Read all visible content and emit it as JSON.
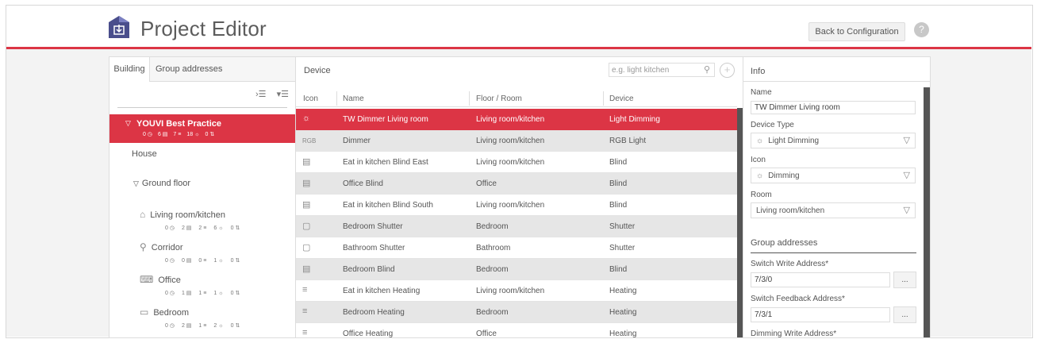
{
  "header": {
    "title": "Project Editor",
    "back_label": "Back to Configuration",
    "help_label": "?"
  },
  "colors": {
    "accent": "#dc3545",
    "selected_row": "#dc3545"
  },
  "left": {
    "tabs": [
      {
        "label": "Building"
      },
      {
        "label": "Group addresses"
      }
    ],
    "tree_tools": [
      "›☰",
      "▾☰"
    ],
    "root": {
      "name": "YOUVI Best Practice",
      "stats": [
        "0 ◷",
        "6 ▤",
        "7 ≡",
        "18 ☼",
        "0 ⇅"
      ]
    },
    "house": "House",
    "floor": "Ground floor",
    "rooms": [
      {
        "name": "Living room/kitchen",
        "icon": "sofa-icon",
        "glyph": "⌂",
        "stats": [
          "0 ◷",
          "2 ▤",
          "2 ≡",
          "6 ☼",
          "0 ⇅"
        ]
      },
      {
        "name": "Corridor",
        "icon": "coat-rack-icon",
        "glyph": "⚲",
        "stats": [
          "0 ◷",
          "0 ▤",
          "0 ≡",
          "1 ☼",
          "0 ⇅"
        ]
      },
      {
        "name": "Office",
        "icon": "desk-icon",
        "glyph": "⌨",
        "stats": [
          "0 ◷",
          "1 ▤",
          "1 ≡",
          "1 ☼",
          "0 ⇅"
        ]
      },
      {
        "name": "Bedroom",
        "icon": "bed-icon",
        "glyph": "▭",
        "stats": [
          "0 ◷",
          "2 ▤",
          "1 ≡",
          "2 ☼",
          "0 ⇅"
        ]
      }
    ]
  },
  "middle": {
    "title": "Device",
    "search_placeholder": "e.g. light kitchen",
    "columns": [
      "Icon",
      "Name",
      "Floor / Room",
      "Device"
    ],
    "rows": [
      {
        "icon": "dimmer-icon",
        "glyph": "☼",
        "name": "TW Dimmer Living room",
        "room": "Living room/kitchen",
        "device": "Light Dimming"
      },
      {
        "icon": "rgb-icon",
        "glyph": "RGB",
        "name": "Dimmer",
        "room": "Living room/kitchen",
        "device": "RGB Light"
      },
      {
        "icon": "blind-icon",
        "glyph": "▤",
        "name": "Eat in kitchen Blind East",
        "room": "Living room/kitchen",
        "device": "Blind"
      },
      {
        "icon": "blind-icon",
        "glyph": "▤",
        "name": "Office Blind",
        "room": "Office",
        "device": "Blind"
      },
      {
        "icon": "blind-icon",
        "glyph": "▤",
        "name": "Eat in kitchen Blind South",
        "room": "Living room/kitchen",
        "device": "Blind"
      },
      {
        "icon": "shutter-icon",
        "glyph": "▢",
        "name": "Bedroom Shutter",
        "room": "Bedroom",
        "device": "Shutter"
      },
      {
        "icon": "shutter-icon",
        "glyph": "▢",
        "name": "Bathroom Shutter",
        "room": "Bathroom",
        "device": "Shutter"
      },
      {
        "icon": "blind-icon",
        "glyph": "▤",
        "name": "Bedroom Blind",
        "room": "Bedroom",
        "device": "Blind"
      },
      {
        "icon": "heating-icon",
        "glyph": "≡",
        "name": "Eat in kitchen Heating",
        "room": "Living room/kitchen",
        "device": "Heating"
      },
      {
        "icon": "heating-icon",
        "glyph": "≡",
        "name": "Bedroom Heating",
        "room": "Bedroom",
        "device": "Heating"
      },
      {
        "icon": "heating-icon",
        "glyph": "≡",
        "name": "Office Heating",
        "room": "Office",
        "device": "Heating"
      }
    ]
  },
  "info": {
    "title": "Info",
    "name_label": "Name",
    "name_value": "TW Dimmer Living room",
    "device_type_label": "Device Type",
    "device_type_value": "Light Dimming",
    "icon_label": "Icon",
    "icon_value": "Dimming",
    "room_label": "Room",
    "room_value": "Living room/kitchen",
    "ga_title": "Group addresses",
    "switch_write_label": "Switch Write Address*",
    "switch_write_value": "7/3/0",
    "switch_feedback_label": "Switch Feedback Address*",
    "switch_feedback_value": "7/3/1",
    "dimming_write_label": "Dimming Write Address*",
    "dots": "..."
  }
}
